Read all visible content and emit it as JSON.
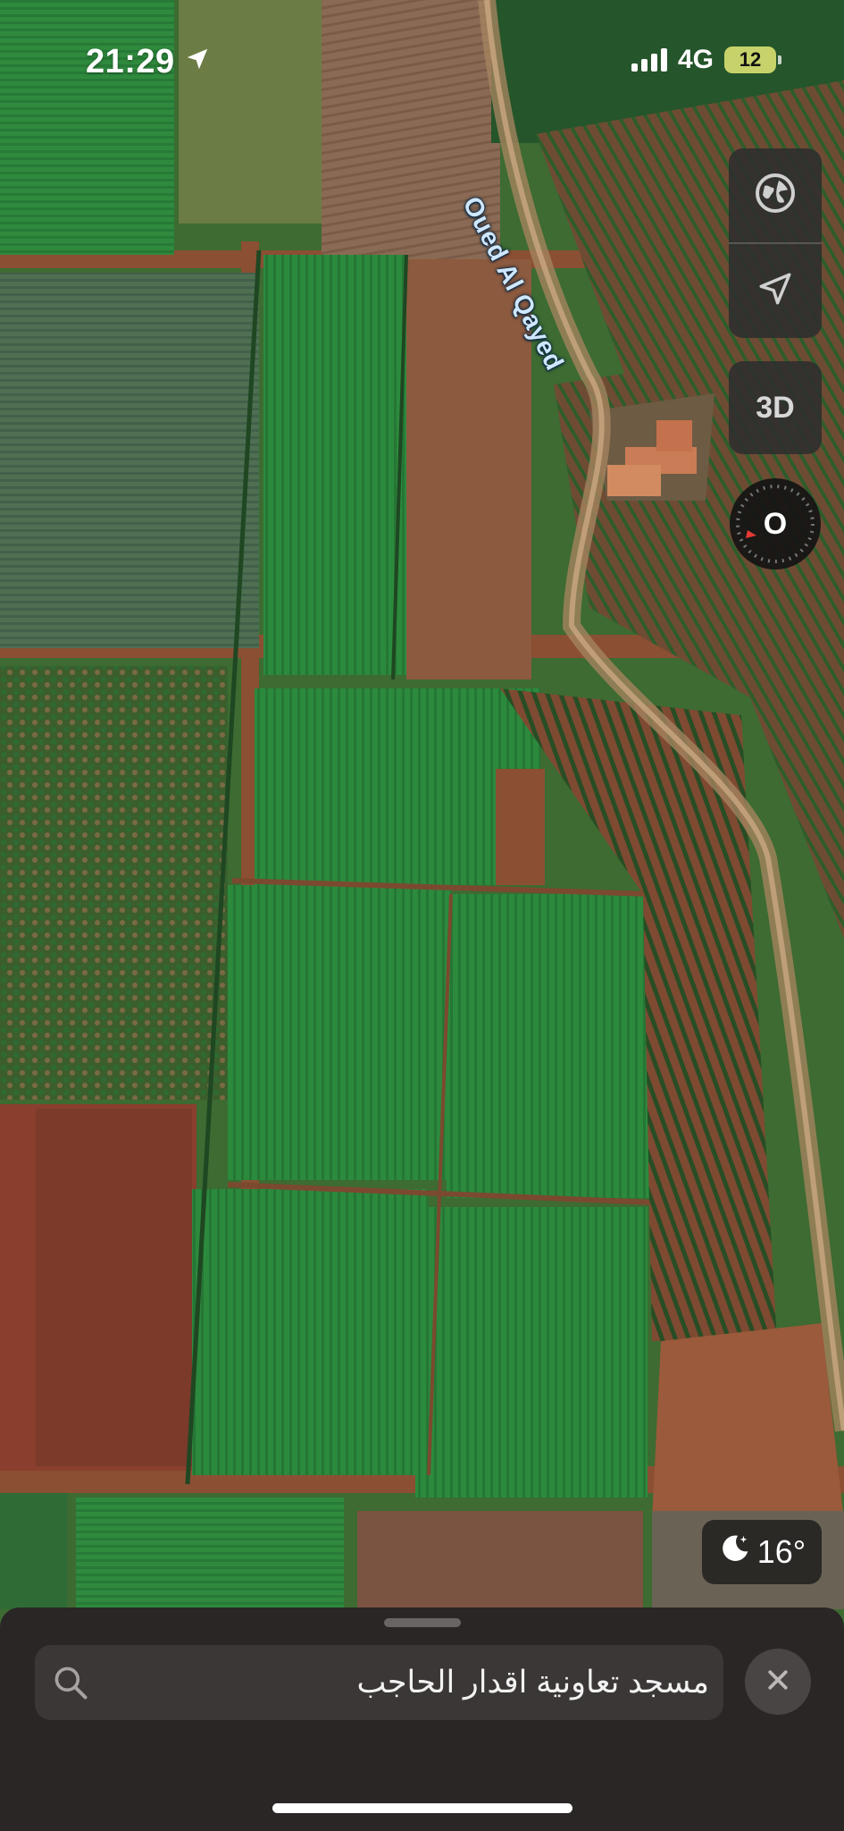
{
  "status_bar": {
    "time": "21:29",
    "network": "4G",
    "battery": "12"
  },
  "map": {
    "road_label": "Oued Al Qayed",
    "colors": {
      "crop_green": "#2e8a3c",
      "dirt": "#8a4e34",
      "water_marker": "#c9e6ff"
    }
  },
  "controls": {
    "map_mode_icon": "globe-icon",
    "locate_icon": "location-arrow-icon",
    "view_3d_label": "3D",
    "compass_label": "O"
  },
  "weather": {
    "icon": "moon-stars-icon",
    "temperature": "16°"
  },
  "search": {
    "query": "مسجد تعاونية اقدار الحاجب",
    "search_icon": "search-icon",
    "clear_icon": "close-icon"
  }
}
